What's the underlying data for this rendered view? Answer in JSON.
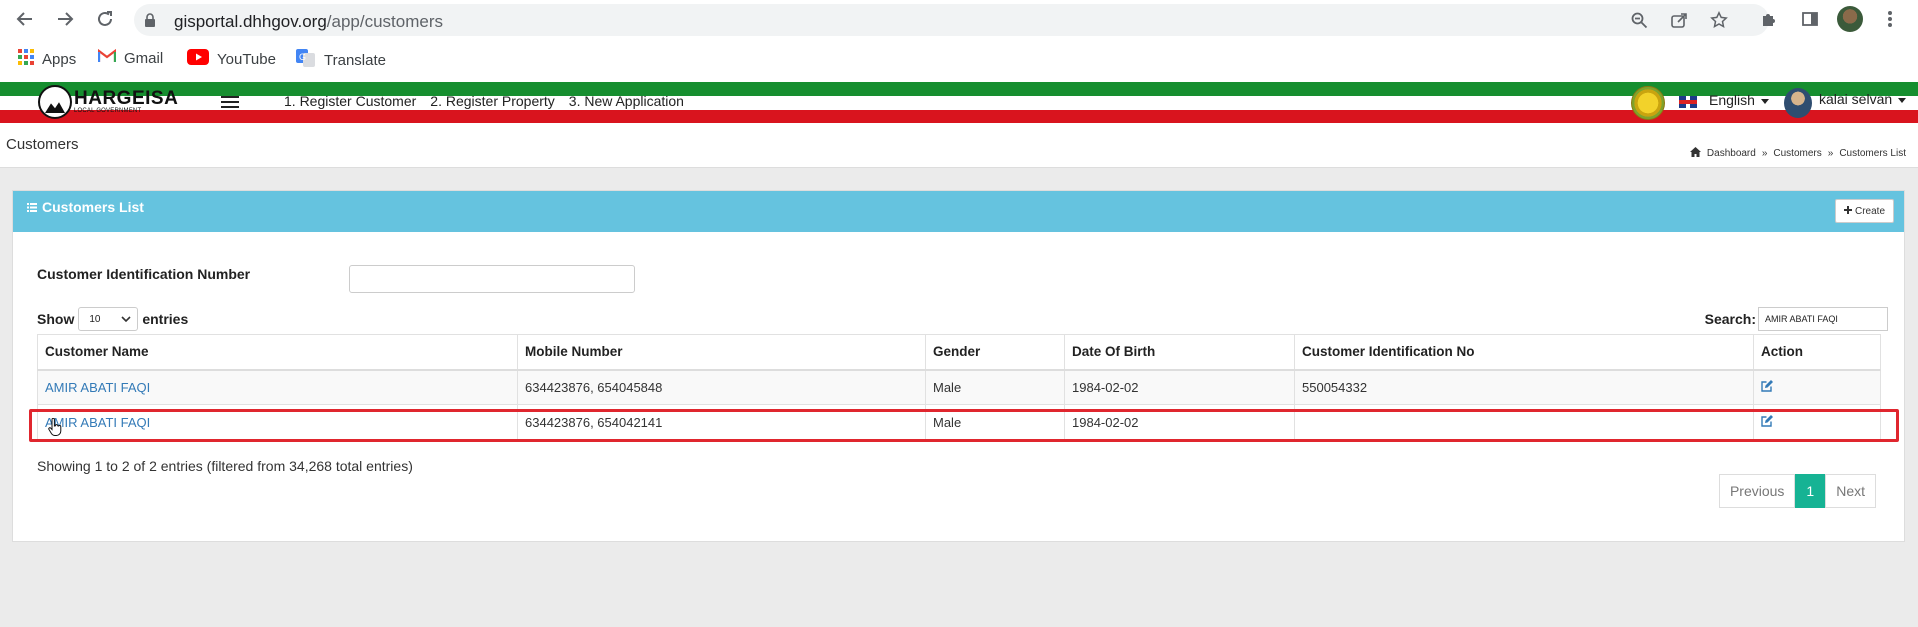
{
  "browser": {
    "url_host": "gisportal.dhhgov.org",
    "url_path": "/app/customers",
    "bookmarks": [
      {
        "label": "Apps",
        "icon": "apps-grid-icon"
      },
      {
        "label": "Gmail",
        "icon": "gmail-icon"
      },
      {
        "label": "YouTube",
        "icon": "youtube-icon"
      },
      {
        "label": "Translate",
        "icon": "translate-icon"
      }
    ]
  },
  "header": {
    "logo_text": "HARGEISA",
    "logo_sub": "LOCAL GOVERNMENT",
    "nav": [
      "1. Register Customer",
      "2. Register Property",
      "3. New Application"
    ],
    "language": "English",
    "user": "kalai selvan",
    "colors": {
      "green": "#168e2f",
      "red": "#d9141e"
    }
  },
  "page": {
    "title": "Customers",
    "breadcrumb": [
      "Dashboard",
      "Customers",
      "Customers List"
    ]
  },
  "panel": {
    "title": "Customers List",
    "create_label": "Create",
    "accent": "#65c3df"
  },
  "filters": {
    "cid_label": "Customer Identification Number",
    "cid_value": "",
    "show_label": "Show",
    "entries_value": "10",
    "entries_label": "entries",
    "search_label": "Search:",
    "search_value": "AMIR ABATI FAQI"
  },
  "table": {
    "columns": [
      "Customer Name",
      "Mobile Number",
      "Gender",
      "Date Of Birth",
      "Customer Identification No",
      "Action"
    ],
    "rows": [
      {
        "name": "AMIR ABATI FAQI",
        "mobile": "634423876, 654045848",
        "gender": "Male",
        "dob": "1984-02-02",
        "cid": "550054332"
      },
      {
        "name": "AMIR ABATI FAQI",
        "mobile": "634423876, 654042141",
        "gender": "Male",
        "dob": "1984-02-02",
        "cid": ""
      }
    ]
  },
  "footer": {
    "info": "Showing 1 to 2 of 2 entries (filtered from 34,268 total entries)",
    "previous": "Previous",
    "page": "1",
    "next": "Next",
    "active_color": "#16b394"
  }
}
